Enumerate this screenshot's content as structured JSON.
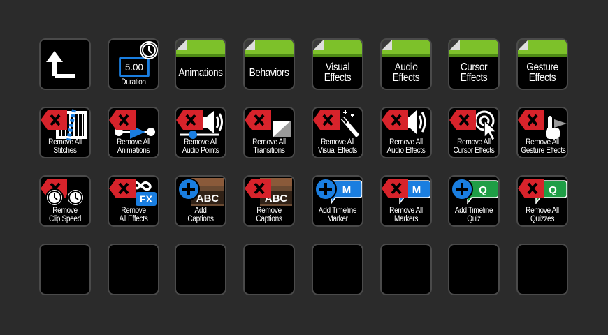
{
  "keys": {
    "back": {
      "icon": "back-arrow-icon"
    },
    "duration": {
      "value": "5.00",
      "label": "Duration"
    },
    "animations": {
      "label": [
        "Animations"
      ]
    },
    "behaviors": {
      "label": [
        "Behaviors"
      ]
    },
    "visual_effects": {
      "label": [
        "Visual",
        "Effects"
      ]
    },
    "audio_effects": {
      "label": [
        "Audio",
        "Effects"
      ]
    },
    "cursor_effects": {
      "label": [
        "Cursor",
        "Effects"
      ]
    },
    "gesture_effects": {
      "label": [
        "Gesture",
        "Effects"
      ]
    },
    "remove_all_stitches": {
      "label": [
        "Remove All",
        "Stitches"
      ]
    },
    "remove_all_animations": {
      "label": [
        "Remove All",
        "Animations"
      ]
    },
    "remove_all_audio_points": {
      "label": [
        "Remove All",
        "Audio Points"
      ]
    },
    "remove_all_transitions": {
      "label": [
        "Remove All",
        "Transitions"
      ]
    },
    "remove_all_visual_effects": {
      "label": [
        "Remove All",
        "Visual Effects"
      ]
    },
    "remove_all_audio_effects": {
      "label": [
        "Remove All",
        "Audio Effects"
      ]
    },
    "remove_all_cursor_effects": {
      "label": [
        "Remove All",
        "Cursor Effects"
      ]
    },
    "remove_all_gesture_effects": {
      "label": [
        "Remove All",
        "Gesture Effects"
      ]
    },
    "remove_clip_speed": {
      "label": [
        "Remove",
        "Clip Speed"
      ]
    },
    "remove_all_effects": {
      "label": [
        "Remove",
        "All Effects"
      ],
      "chip": "FX"
    },
    "add_captions": {
      "label": [
        "Add",
        "Captions"
      ],
      "chip": "ABC"
    },
    "remove_captions": {
      "label": [
        "Remove",
        "Captions"
      ],
      "chip": "ABC"
    },
    "add_timeline_marker": {
      "label": [
        "Add Timeline",
        "Marker"
      ],
      "chip": "M"
    },
    "remove_all_markers": {
      "label": [
        "Remove All",
        "Markers"
      ],
      "chip": "M"
    },
    "add_timeline_quiz": {
      "label": [
        "Add Timeline",
        "Quiz"
      ],
      "chip": "Q"
    },
    "remove_all_quizzes": {
      "label": [
        "Remove All",
        "Quizzes"
      ],
      "chip": "Q"
    }
  },
  "colors": {
    "background": "#2b2b2b",
    "key_bg": "#000000",
    "key_border": "#4a4a4a",
    "remove_red": "#d7232b",
    "add_blue": "#1a7ee0",
    "folder_green": "#7dc12a",
    "quiz_green": "#1f9e46"
  }
}
